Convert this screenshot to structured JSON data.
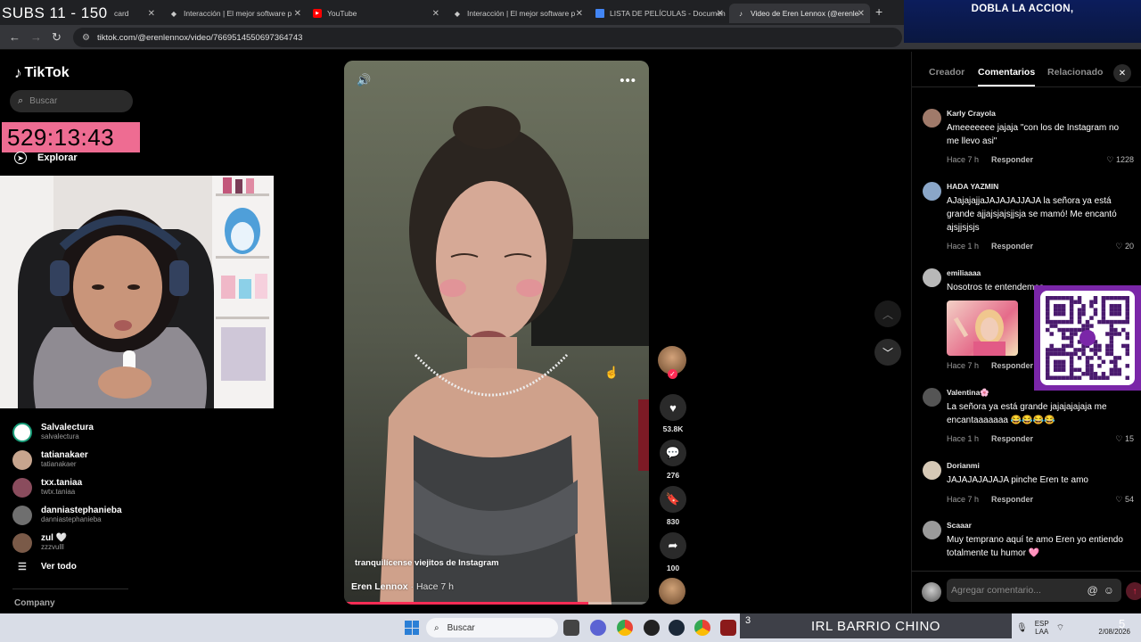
{
  "browser": {
    "tabs": [
      {
        "label": "card",
        "icon": "dashboard-icon"
      },
      {
        "label": "Interacción | El mejor software p",
        "icon": "pocket-icon"
      },
      {
        "label": "YouTube",
        "icon": "youtube-icon"
      },
      {
        "label": "Interacción | El mejor software p",
        "icon": "pocket-icon"
      },
      {
        "label": "LISTA DE PELÍCULAS - Documen",
        "icon": "docs-icon"
      },
      {
        "label": "Video de Eren Lennox (@erenle",
        "icon": "tiktok-icon"
      }
    ],
    "url": "tiktok.com/@erenlennox/video/7669514550697364743"
  },
  "overlays": {
    "subs": "SUBS 11 - 150",
    "timer": "529:13:43",
    "dobla": "DOBLA LA ACCION,",
    "barrio": "IRL BARRIO CHINO",
    "counter": "3"
  },
  "sidebar": {
    "logo": "TikTok",
    "search_placeholder": "Buscar",
    "explore": "Explorar",
    "following": [
      {
        "name": "Salvalectura",
        "handle": "salvalectura",
        "color": "#e9e9e9"
      },
      {
        "name": "tatianakaer",
        "handle": "tatianakaer",
        "color": "#c7a58e"
      },
      {
        "name": "txx.taniaa",
        "handle": "twtx.taniaa",
        "color": "#8a4c5d"
      },
      {
        "name": "danniastephanieba",
        "handle": "danniastephanieba",
        "color": "#6f6f6f"
      },
      {
        "name": "zul 🤍",
        "handle": "zzzvulll",
        "color": "#7a5a48"
      }
    ],
    "see_all": "Ver todo",
    "company": "Company"
  },
  "video": {
    "caption": "tranquilícense viejitos de Instagram",
    "author": "Eren Lennox",
    "time": " · Hace 7 h",
    "progress": 0.8,
    "likes": "53.8K",
    "comments": "276",
    "saves": "830",
    "shares": "100"
  },
  "panel": {
    "tabs": [
      "Creador",
      "Comentarios",
      "Relacionado"
    ],
    "active_tab": "Comentarios",
    "reply_label": "Responder",
    "comments": [
      {
        "user": "Karly Crayola",
        "text": "Ameeeeeee jajaja \"con los de Instagram no me llevo asi\"",
        "time": "Hace 7 h",
        "likes": "♡ 1228",
        "color": "#a07a6a"
      },
      {
        "user": "HADA YAZMIN",
        "text": "AJajajajjaJAJAJAJJAJA la señora ya está grande ajjajsjajsjjsja se mamó! Me encantó ajsjjsjsjs",
        "time": "Hace 1 h",
        "likes": "♡ 20",
        "color": "#8aa6c8"
      },
      {
        "user": "emiliaaaa",
        "text": "Nosotros te entendemos",
        "time": "Hace 7 h",
        "likes": "",
        "color": "#b8b8b8"
      },
      {
        "user": "Valentina🌸",
        "text": "La señora ya está grande jajajajajaja me encantaaaaaaa 😂😂😂😂",
        "time": "Hace 1 h",
        "likes": "♡ 15",
        "color": "#555"
      },
      {
        "user": "Dorianmi",
        "text": "JAJAJAJAJAJA pinche Eren te amo",
        "time": "Hace 7 h",
        "likes": "♡ 54",
        "color": "#d6c9b6"
      },
      {
        "user": "Scaaar",
        "text": "Muy temprano aquí te amo Eren yo entiendo totalmente tu humor 🩷",
        "time": "",
        "likes": "",
        "color": "#9a9a9a"
      }
    ],
    "add_placeholder": "Agregar comentario..."
  },
  "taskbar": {
    "search": "Buscar",
    "lang": "ESP\nLAA",
    "date": "2/08/2026"
  }
}
